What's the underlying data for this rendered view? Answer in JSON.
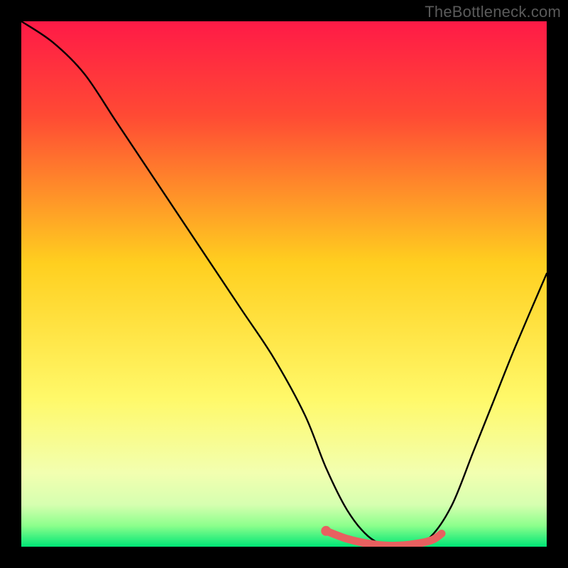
{
  "watermark": "TheBottleneck.com",
  "colors": {
    "grad_top": "#ff1a47",
    "grad_upper_mid": "#ff5a2a",
    "grad_mid": "#ffcf1f",
    "grad_lower": "#fff96a",
    "grad_pale": "#f2ffb0",
    "grad_green1": "#8cff8c",
    "grad_green2": "#00e676",
    "frame": "#000000",
    "curve": "#000000",
    "marker": "#e86060"
  },
  "chart_data": {
    "type": "line",
    "title": "",
    "xlabel": "",
    "ylabel": "",
    "xlim": [
      0,
      100
    ],
    "ylim": [
      0,
      100
    ],
    "grid": false,
    "legend": false,
    "series": [
      {
        "name": "bottleneck-curve",
        "x": [
          0,
          6,
          12,
          18,
          24,
          30,
          36,
          42,
          48,
          54,
          58,
          62,
          66,
          70,
          74,
          78,
          82,
          86,
          90,
          94,
          100
        ],
        "y": [
          100,
          96,
          90,
          81,
          72,
          63,
          54,
          45,
          36,
          25,
          15,
          7,
          2,
          0,
          0,
          2,
          8,
          18,
          28,
          38,
          52
        ]
      }
    ],
    "markers": {
      "name": "highlight-band",
      "x": [
        58,
        62,
        66,
        70,
        74,
        78,
        80
      ],
      "y": [
        3,
        1.5,
        0.6,
        0.2,
        0.4,
        1.2,
        2.5
      ]
    }
  }
}
